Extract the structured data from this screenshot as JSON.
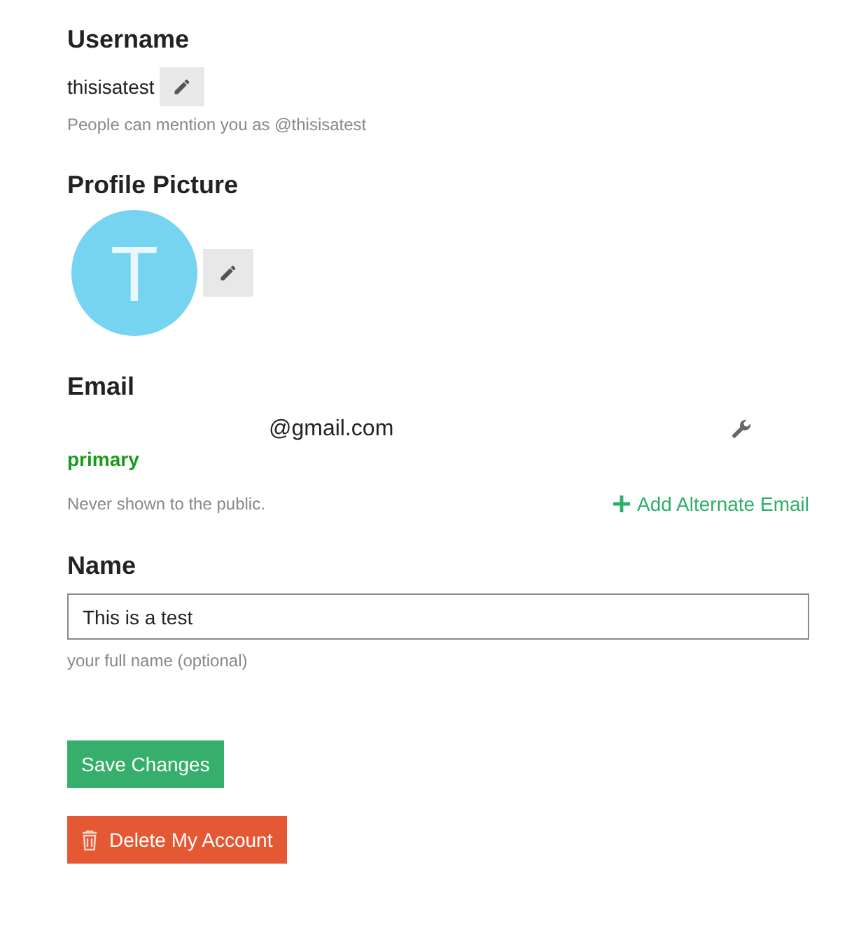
{
  "username": {
    "heading": "Username",
    "value": "thisisatest",
    "hint": "People can mention you as @thisisatest"
  },
  "profile_picture": {
    "heading": "Profile Picture",
    "avatar_letter": "T",
    "color": "#76d4f0"
  },
  "email": {
    "heading": "Email",
    "address": "@gmail.com",
    "badge": "primary",
    "hint": "Never shown to the public.",
    "add_link": "Add Alternate Email"
  },
  "name": {
    "heading": "Name",
    "value": "This is a test",
    "hint": "your full name (optional)"
  },
  "buttons": [
    {
      "kind": "save",
      "label": "Save Changes"
    },
    {
      "kind": "delete",
      "label": "Delete My Account"
    }
  ]
}
